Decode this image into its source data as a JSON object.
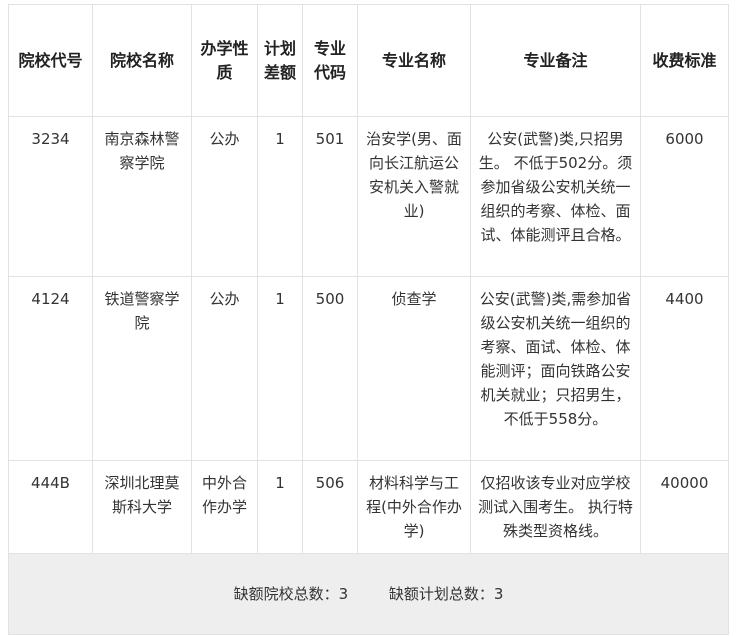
{
  "table": {
    "headers": [
      "院校代号",
      "院校名称",
      "办学性质",
      "计划差额",
      "专业代码",
      "专业名称",
      "专业备注",
      "收费标准"
    ],
    "rows": [
      [
        "3234",
        "南京森林警察学院",
        "公办",
        "1",
        "501",
        "治安学(男、面向长江航运公安机关入警就业)",
        "公安(武警)类,只招男生。 不低于502分。须参加省级公安机关统一组织的考察、体检、面试、体能测评且合格。",
        "6000"
      ],
      [
        "4124",
        "铁道警察学院",
        "公办",
        "1",
        "500",
        "侦查学",
        "公安(武警)类,需参加省级公安机关统一组织的考察、面试、体检、体能测评；面向铁路公安机关就业；只招男生，不低于558分。",
        "4400"
      ],
      [
        "444B",
        "深圳北理莫斯科大学",
        "中外合作办学",
        "1",
        "506",
        "材料科学与工程(中外合作办学)",
        "仅招收该专业对应学校测试入围考生。 执行特殊类型资格线。",
        "40000"
      ]
    ],
    "summary": {
      "schools": "缺额院校总数：3",
      "plans": "缺额计划总数：3"
    }
  }
}
